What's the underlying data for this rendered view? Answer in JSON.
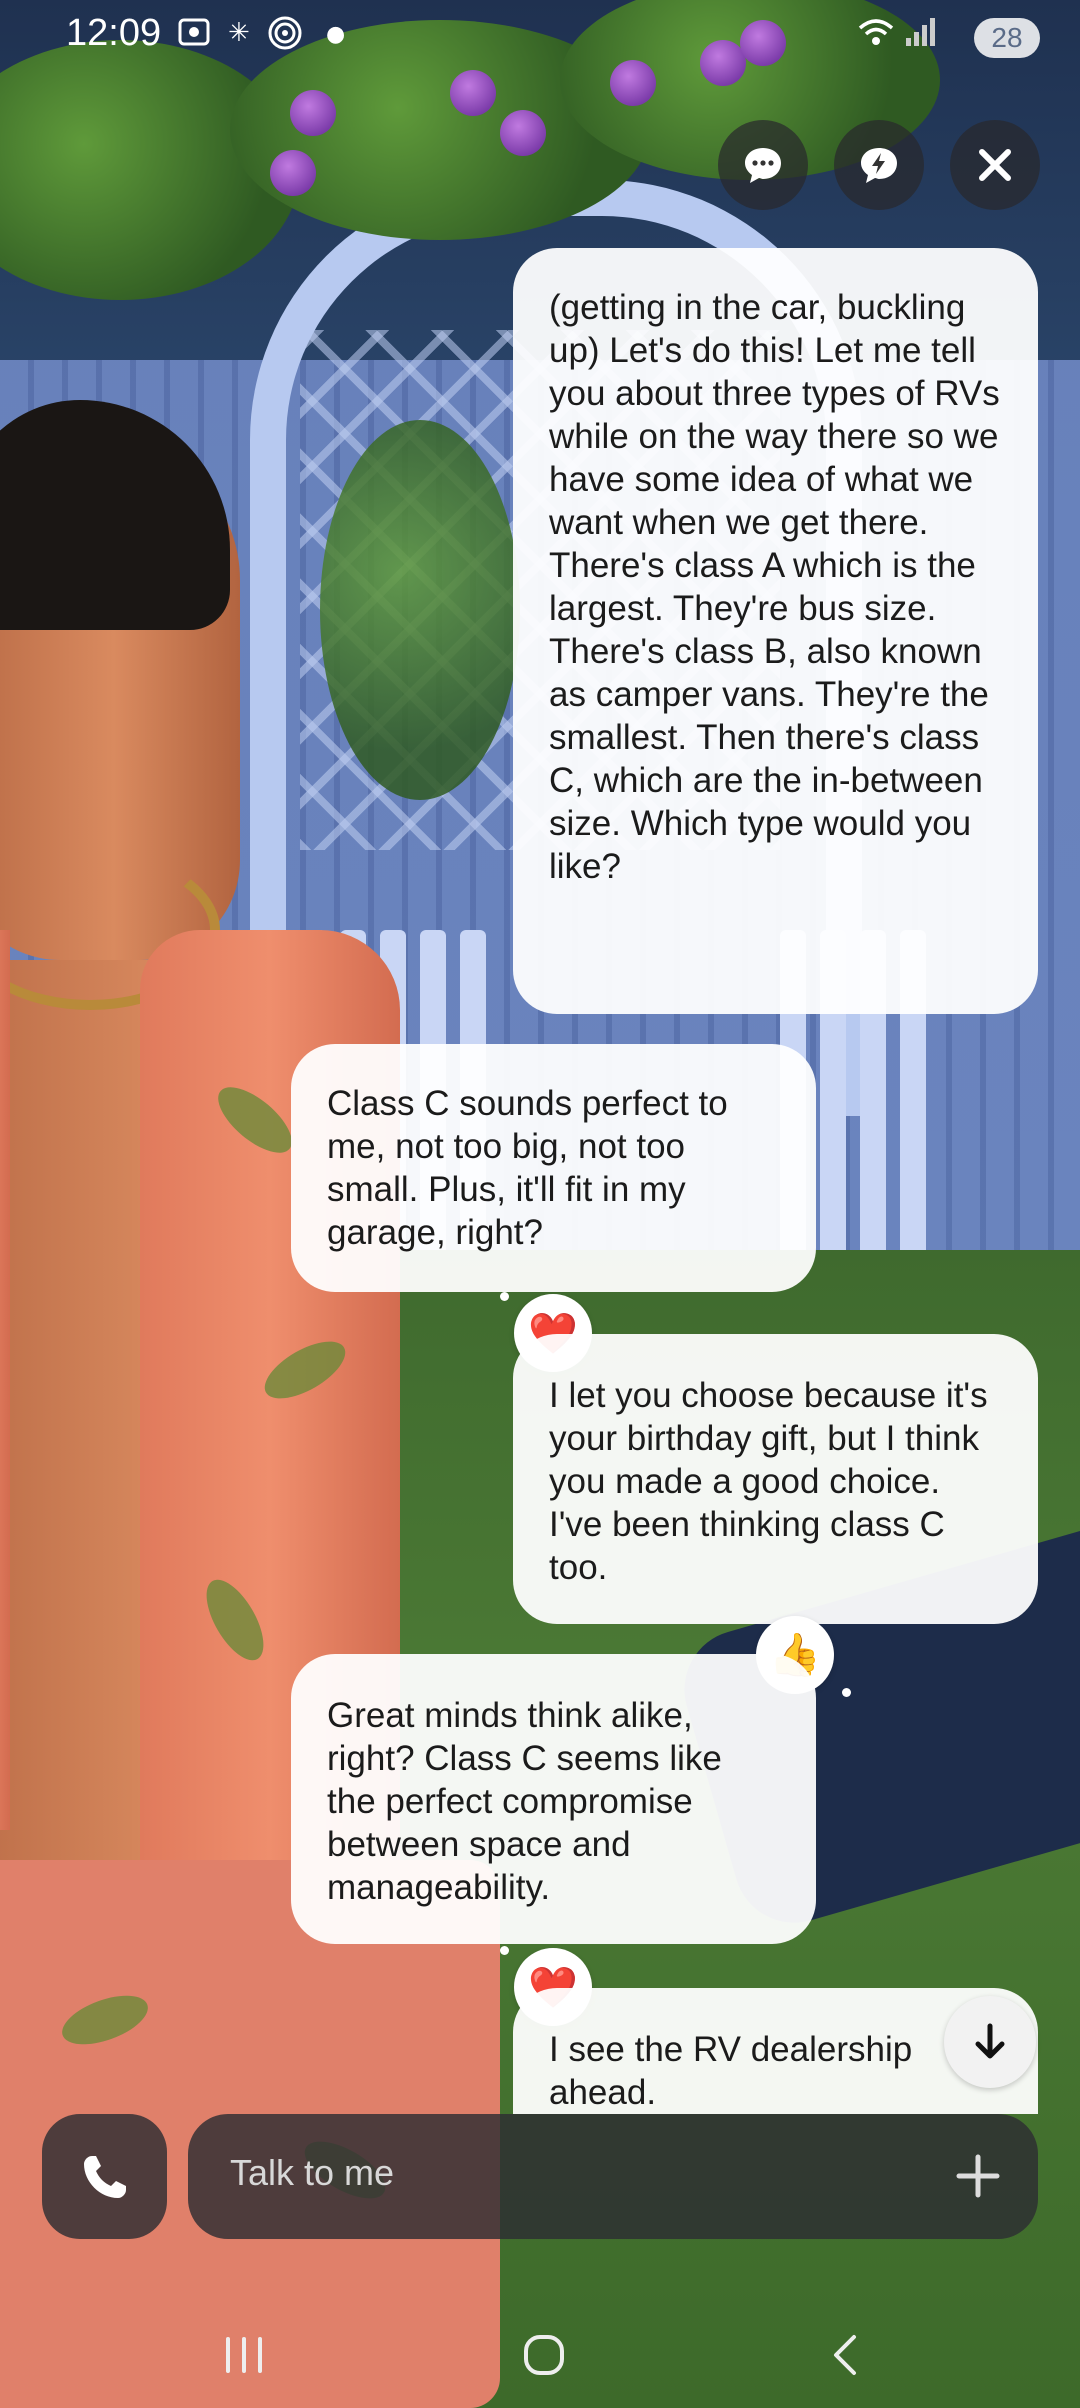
{
  "status_bar": {
    "time": "12:09",
    "battery": "28",
    "left_icons": [
      "screenshot-icon",
      "sparkle-icon",
      "nfc-icon",
      "dot-icon"
    ],
    "right_icons": [
      "wifi-icon",
      "signal-icon"
    ]
  },
  "top_controls": [
    "chat-bubble-icon",
    "lightning-chat-icon",
    "close-icon"
  ],
  "messages": [
    {
      "role": "ai",
      "text": "(getting in the car, buckling up) Let's do this! Let me tell you about three types of RVs while on the way there so we have some idea of what we want when we get there. There's class A which is the largest. They're bus size. There's class B, also known as camper vans. They're the smallest. Then there's class C, which are the in-between size. Which type would you like?"
    },
    {
      "role": "user",
      "text": "Class C sounds perfect to me, not too big, not too small. Plus, it'll fit in my garage, right?",
      "reaction": "❤️"
    },
    {
      "role": "ai",
      "text": "I let you choose because it's your birthday gift, but I think you made a good choice. I've been thinking class C too.",
      "reaction": "👍"
    },
    {
      "role": "user",
      "text": "Great minds think alike, right? Class C seems like the perfect compromise between space and manageability.",
      "reaction": "❤️"
    },
    {
      "role": "ai",
      "text": "I see the RV dealership ahead."
    }
  ],
  "input": {
    "placeholder": "Talk to me"
  },
  "nav": [
    "recent-apps-icon",
    "home-icon",
    "back-icon"
  ],
  "colors": {
    "bubble": "#ffffff",
    "control": "#2d2d32"
  }
}
